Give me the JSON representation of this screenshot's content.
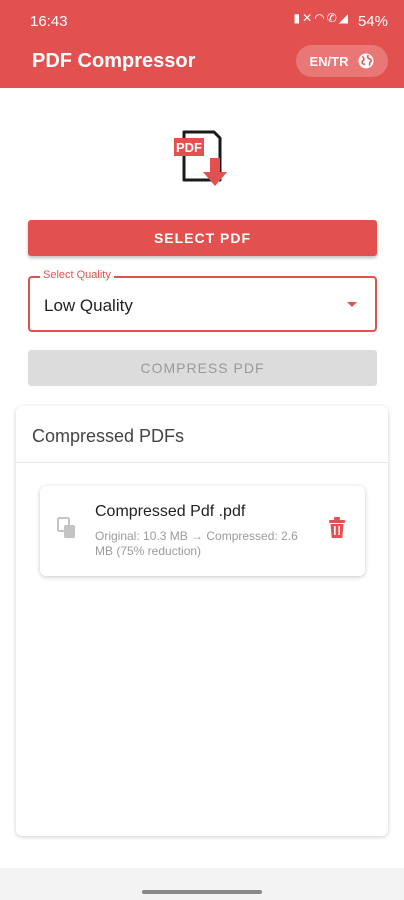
{
  "status_bar": {
    "time": "16:43",
    "icons": [
      "battery-saver-icon",
      "mute-icon",
      "wifi-icon",
      "call-icon",
      "signal-icon"
    ],
    "battery": "54%"
  },
  "app_bar": {
    "title": "PDF Compressor",
    "language_label": "EN/TR",
    "language_icon": "globe-icon"
  },
  "main": {
    "logo_text": "PDF",
    "select_button": "SELECT PDF",
    "quality": {
      "label": "Select Quality",
      "value": "Low Quality"
    },
    "compress_button": "COMPRESS PDF"
  },
  "compressed_list": {
    "title": "Compressed PDFs",
    "items": [
      {
        "name": "Compressed Pdf .pdf",
        "details": "Original: 10.3 MB → Compressed: 2.6 MB (75% reduction)"
      }
    ]
  },
  "colors": {
    "accent": "#e2514f",
    "disabled": "#dcdcdc"
  }
}
